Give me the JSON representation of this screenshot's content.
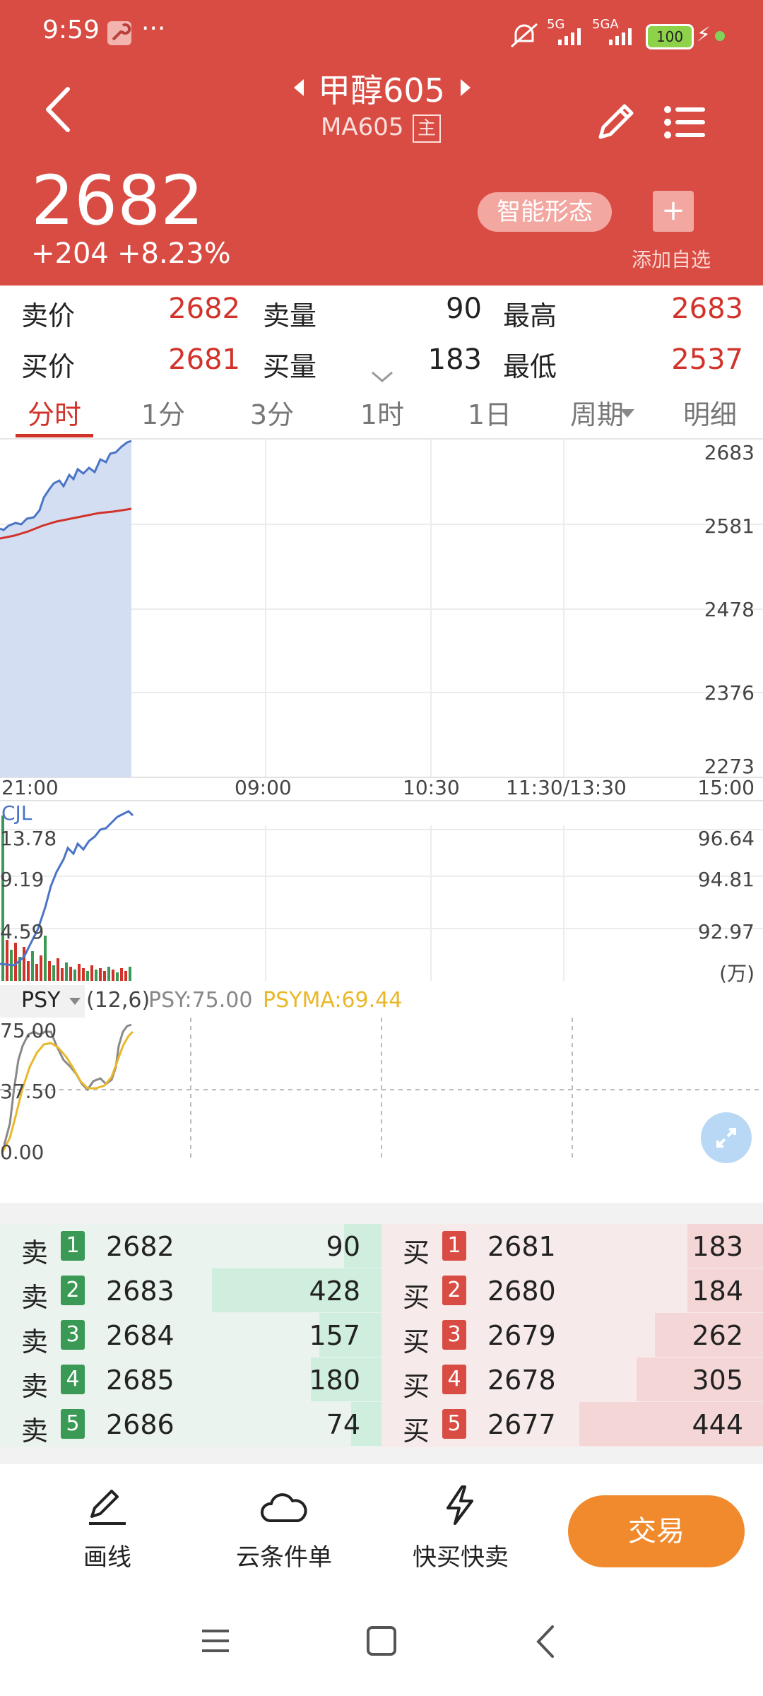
{
  "status_bar": {
    "time": "9:59",
    "icons": [
      "wrench-icon",
      "more-icon"
    ],
    "net1": "5G",
    "net2": "5GA",
    "battery": "100"
  },
  "header": {
    "title": "甲醇605",
    "code": "MA605",
    "badge": "主",
    "price": "2682",
    "change": "+204",
    "change_pct": "+8.23%",
    "smart_button": "智能形态",
    "add_watch_label": "添加自选",
    "add_watch_icon": "+"
  },
  "quote": {
    "sell_price_label": "卖价",
    "sell_price": "2682",
    "sell_vol_label": "卖量",
    "sell_vol": "90",
    "high_label": "最高",
    "high": "2683",
    "buy_price_label": "买价",
    "buy_price": "2681",
    "buy_vol_label": "买量",
    "buy_vol": "183",
    "low_label": "最低",
    "low": "2537"
  },
  "tabs": [
    "分时",
    "1分",
    "3分",
    "1时",
    "1日",
    "周期",
    "明细"
  ],
  "main_chart": {
    "y_ticks": [
      "2683",
      "2581",
      "2478",
      "2376",
      "2273"
    ],
    "x_ticks": [
      "21:00",
      "09:00",
      "10:30",
      "11:30/13:30",
      "15:00"
    ]
  },
  "volume_chart": {
    "label": "CJL",
    "left_ticks": [
      "13.78",
      "9.19",
      "4.59"
    ],
    "right_ticks": [
      "96.64",
      "94.81",
      "92.97"
    ],
    "unit": "(万)"
  },
  "psy": {
    "name": "PSY",
    "params": "(12,6)",
    "psy_value": "PSY:75.00",
    "psyma_value": "PSYMA:69.44",
    "ticks": [
      "75.00",
      "37.50",
      "0.00"
    ],
    "psyma_color": "#e9b82a"
  },
  "order_book": {
    "sell_label": "卖",
    "buy_label": "买",
    "sells": [
      {
        "level": "1",
        "price": "2682",
        "vol": "90",
        "depth": 0.21
      },
      {
        "level": "2",
        "price": "2683",
        "vol": "428",
        "depth": 0.96
      },
      {
        "level": "3",
        "price": "2684",
        "vol": "157",
        "depth": 0.35
      },
      {
        "level": "4",
        "price": "2685",
        "vol": "180",
        "depth": 0.4
      },
      {
        "level": "5",
        "price": "2686",
        "vol": "74",
        "depth": 0.17
      }
    ],
    "buys": [
      {
        "level": "1",
        "price": "2681",
        "vol": "183",
        "depth": 0.41
      },
      {
        "level": "2",
        "price": "2680",
        "vol": "184",
        "depth": 0.41
      },
      {
        "level": "3",
        "price": "2679",
        "vol": "262",
        "depth": 0.59
      },
      {
        "level": "4",
        "price": "2678",
        "vol": "305",
        "depth": 0.69
      },
      {
        "level": "5",
        "price": "2677",
        "vol": "444",
        "depth": 1.0
      }
    ]
  },
  "bottom_bar": {
    "draw": "画线",
    "cloud": "云条件单",
    "quick": "快买快卖",
    "trade": "交易"
  },
  "colors": {
    "header_red": "#d94c43",
    "price_red": "#d1332b",
    "sell_green": "#3a9a55",
    "trade_orange": "#f08a2c",
    "line_blue": "#4a74c6"
  }
}
